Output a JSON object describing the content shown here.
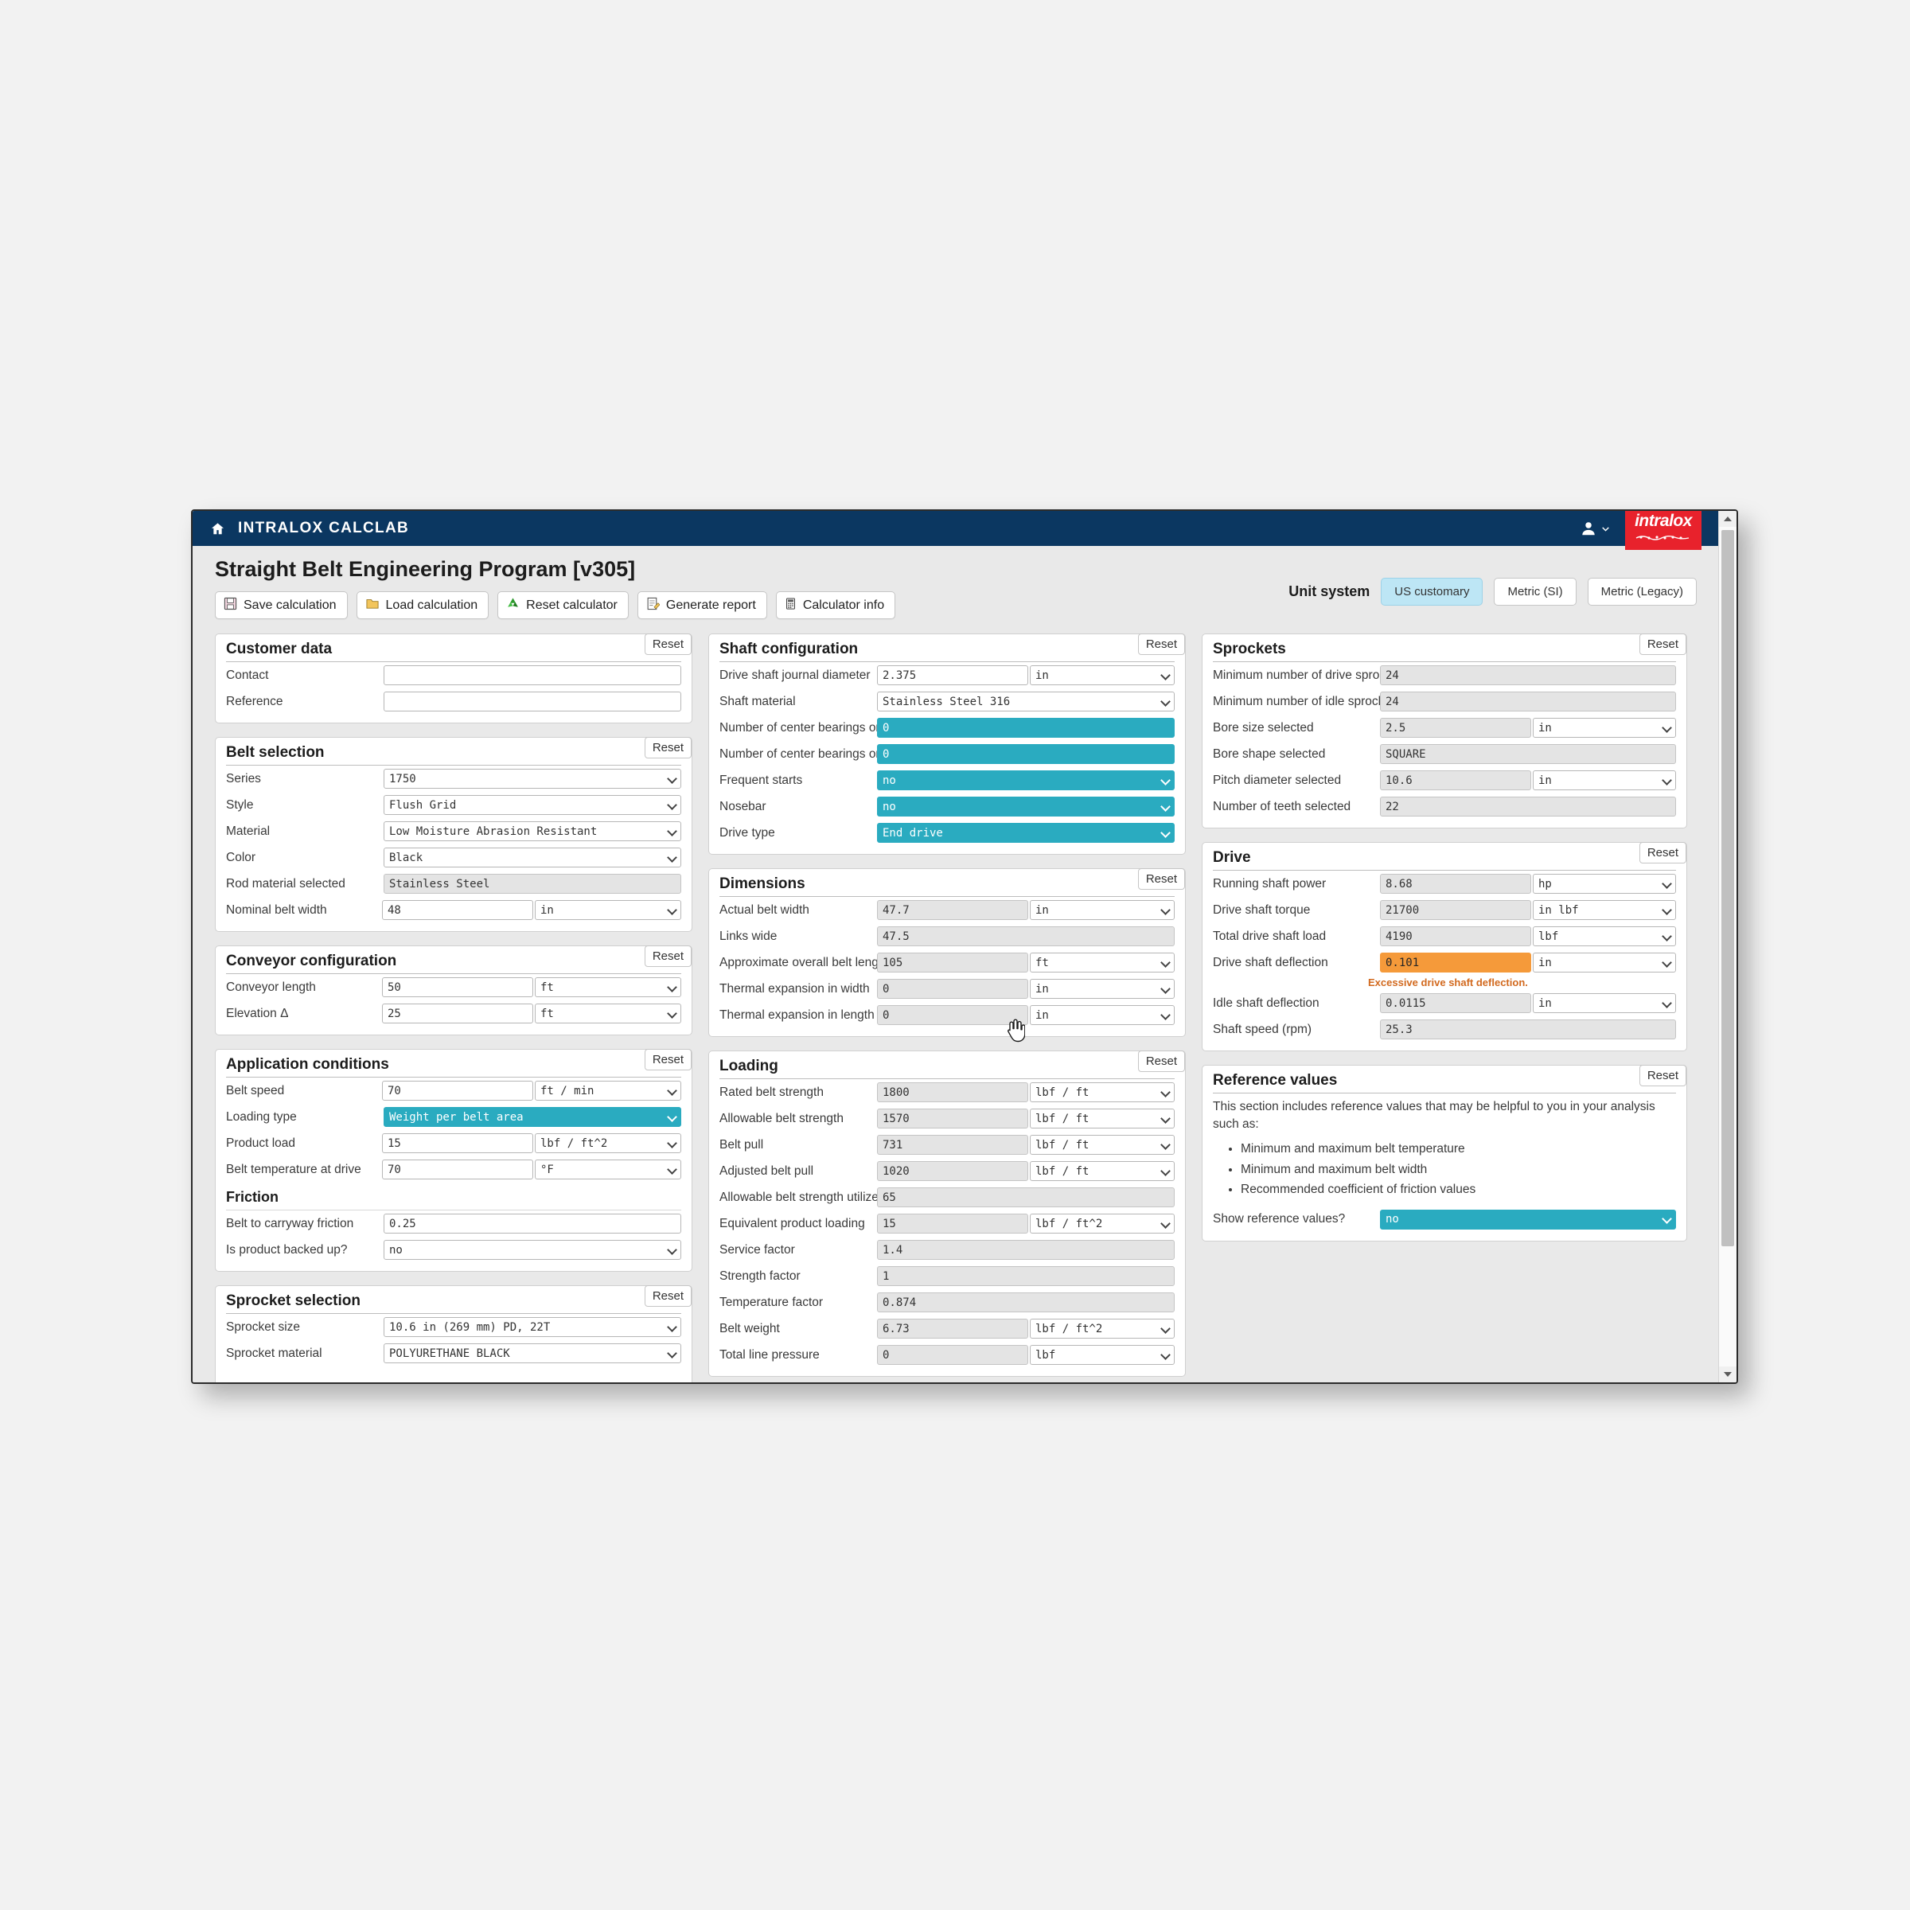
{
  "navbar": {
    "brand": "INTRALOX CALCLAB",
    "home_icon": "home-icon",
    "user_icon": "user-account-icon",
    "logo_text": "intralox"
  },
  "header": {
    "page_title": "Straight Belt Engineering Program [v305]",
    "toolbar": [
      {
        "label": "Save calculation",
        "icon": "floppy-disk-icon"
      },
      {
        "label": "Load calculation",
        "icon": "folder-open-icon"
      },
      {
        "label": "Reset calculator",
        "icon": "recycle-icon"
      },
      {
        "label": "Generate report",
        "icon": "report-pencil-icon"
      },
      {
        "label": "Calculator info",
        "icon": "calculator-icon"
      }
    ],
    "unit_system": {
      "label": "Unit system",
      "options": [
        "US customary",
        "Metric (SI)",
        "Metric (Legacy)"
      ],
      "selected": "US customary"
    }
  },
  "reset_label": "Reset",
  "colors": {
    "navy": "#0b3761",
    "brand_red": "#e8222c",
    "teal_highlight": "#2aabc0",
    "warning_orange": "#f59a3a",
    "warning_text": "#d2691e",
    "active_tab": "#bde6f5"
  },
  "panels": {
    "customer_data": {
      "title": "Customer data",
      "rows": [
        {
          "label": "Contact",
          "value": "",
          "kind": "text"
        },
        {
          "label": "Reference",
          "value": "",
          "kind": "text"
        }
      ]
    },
    "belt_selection": {
      "title": "Belt selection",
      "rows": [
        {
          "label": "Series",
          "value": "1750",
          "kind": "select"
        },
        {
          "label": "Style",
          "value": "Flush Grid",
          "kind": "select"
        },
        {
          "label": "Material",
          "value": "Low Moisture Abrasion Resistant",
          "kind": "select"
        },
        {
          "label": "Color",
          "value": "Black",
          "kind": "select"
        },
        {
          "label": "Rod material selected",
          "value": "Stainless Steel",
          "kind": "readonly"
        },
        {
          "label": "Nominal belt width",
          "value": "48",
          "unit": "in",
          "kind": "value-unit"
        }
      ]
    },
    "conveyor_configuration": {
      "title": "Conveyor configuration",
      "rows": [
        {
          "label": "Conveyor length",
          "value": "50",
          "unit": "ft",
          "kind": "value-unit"
        },
        {
          "label": "Elevation Δ",
          "value": "25",
          "unit": "ft",
          "kind": "value-unit"
        }
      ]
    },
    "application_conditions": {
      "title": "Application conditions",
      "rows": [
        {
          "label": "Belt speed",
          "value": "70",
          "unit": "ft / min",
          "kind": "value-unit"
        },
        {
          "label": "Loading type",
          "value": "Weight per belt area",
          "kind": "select-teal"
        },
        {
          "label": "Product load",
          "value": "15",
          "unit": "lbf / ft^2",
          "kind": "value-unit"
        },
        {
          "label": "Belt temperature at drive",
          "value": "70",
          "unit": "°F",
          "kind": "value-unit"
        }
      ],
      "friction": {
        "title": "Friction",
        "rows": [
          {
            "label": "Belt to carryway friction",
            "value": "0.25",
            "kind": "text"
          },
          {
            "label": "Is product backed up?",
            "value": "no",
            "kind": "select"
          }
        ]
      }
    },
    "sprocket_selection": {
      "title": "Sprocket selection",
      "rows": [
        {
          "label": "Sprocket size",
          "value": "10.6 in (269 mm) PD, 22T",
          "kind": "select"
        },
        {
          "label": "Sprocket material",
          "value": "POLYURETHANE BLACK",
          "kind": "select"
        }
      ]
    },
    "shaft_configuration": {
      "title": "Shaft configuration",
      "rows": [
        {
          "label": "Drive shaft journal diameter",
          "value": "2.375",
          "unit": "in",
          "kind": "value-unit"
        },
        {
          "label": "Shaft material",
          "value": "Stainless Steel 316",
          "kind": "select"
        },
        {
          "label": "Number of center bearings on drive shaft",
          "value": "0",
          "kind": "teal"
        },
        {
          "label": "Number of center bearings on idle shaft",
          "value": "0",
          "kind": "teal"
        },
        {
          "label": "Frequent starts",
          "value": "no",
          "kind": "select-teal"
        },
        {
          "label": "Nosebar",
          "value": "no",
          "kind": "select-teal"
        },
        {
          "label": "Drive type",
          "value": "End drive",
          "kind": "select-teal"
        }
      ]
    },
    "dimensions": {
      "title": "Dimensions",
      "rows": [
        {
          "label": "Actual belt width",
          "value": "47.7",
          "unit": "in",
          "kind": "ro-value-unit"
        },
        {
          "label": "Links wide",
          "value": "47.5",
          "kind": "readonly"
        },
        {
          "label": "Approximate overall belt length",
          "value": "105",
          "unit": "ft",
          "kind": "ro-value-unit"
        },
        {
          "label": "Thermal expansion in width",
          "value": "0",
          "unit": "in",
          "kind": "ro-value-unit"
        },
        {
          "label": "Thermal expansion in length",
          "value": "0",
          "unit": "in",
          "kind": "ro-value-unit"
        }
      ]
    },
    "loading": {
      "title": "Loading",
      "rows": [
        {
          "label": "Rated belt strength",
          "value": "1800",
          "unit": "lbf / ft",
          "kind": "ro-value-unit"
        },
        {
          "label": "Allowable belt strength",
          "value": "1570",
          "unit": "lbf / ft",
          "kind": "ro-value-unit"
        },
        {
          "label": "Belt pull",
          "value": "731",
          "unit": "lbf / ft",
          "kind": "ro-value-unit"
        },
        {
          "label": "Adjusted belt pull",
          "value": "1020",
          "unit": "lbf / ft",
          "kind": "ro-value-unit"
        },
        {
          "label": "Allowable belt strength utilized (%)",
          "value": "65",
          "kind": "readonly"
        },
        {
          "label": "Equivalent product loading",
          "value": "15",
          "unit": "lbf / ft^2",
          "kind": "ro-value-unit"
        },
        {
          "label": "Service factor",
          "value": "1.4",
          "kind": "readonly"
        },
        {
          "label": "Strength factor",
          "value": "1",
          "kind": "readonly"
        },
        {
          "label": "Temperature factor",
          "value": "0.874",
          "kind": "readonly"
        },
        {
          "label": "Belt weight",
          "value": "6.73",
          "unit": "lbf / ft^2",
          "kind": "ro-value-unit"
        },
        {
          "label": "Total line pressure",
          "value": "0",
          "unit": "lbf",
          "kind": "ro-value-unit"
        }
      ]
    },
    "sprockets": {
      "title": "Sprockets",
      "rows": [
        {
          "label": "Minimum number of drive sprockets",
          "value": "24",
          "kind": "readonly"
        },
        {
          "label": "Minimum number of idle sprockets",
          "value": "24",
          "kind": "readonly"
        },
        {
          "label": "Bore size selected",
          "value": "2.5",
          "unit": "in",
          "kind": "ro-value-unit"
        },
        {
          "label": "Bore shape selected",
          "value": "SQUARE",
          "kind": "readonly"
        },
        {
          "label": "Pitch diameter selected",
          "value": "10.6",
          "unit": "in",
          "kind": "ro-value-unit"
        },
        {
          "label": "Number of teeth selected",
          "value": "22",
          "kind": "readonly"
        }
      ]
    },
    "drive": {
      "title": "Drive",
      "rows": [
        {
          "label": "Running shaft power",
          "value": "8.68",
          "unit": "hp",
          "kind": "ro-value-unit"
        },
        {
          "label": "Drive shaft torque",
          "value": "21700",
          "unit": "in lbf",
          "kind": "ro-value-unit"
        },
        {
          "label": "Total drive shaft load",
          "value": "4190",
          "unit": "lbf",
          "kind": "ro-value-unit"
        },
        {
          "label": "Drive shaft deflection",
          "value": "0.101",
          "unit": "in",
          "kind": "warn-value-unit"
        },
        {
          "label": "Idle shaft deflection",
          "value": "0.0115",
          "unit": "in",
          "kind": "ro-value-unit"
        },
        {
          "label": "Shaft speed (rpm)",
          "value": "25.3",
          "kind": "readonly"
        }
      ],
      "warning": "Excessive drive shaft deflection."
    },
    "reference_values": {
      "title": "Reference values",
      "intro": "This section includes reference values that may be helpful to you in your analysis such as:",
      "bullets": [
        "Minimum and maximum belt temperature",
        "Minimum and maximum belt width",
        "Recommended coefficient of friction values"
      ],
      "show_label": "Show reference values?",
      "show_value": "no"
    }
  }
}
